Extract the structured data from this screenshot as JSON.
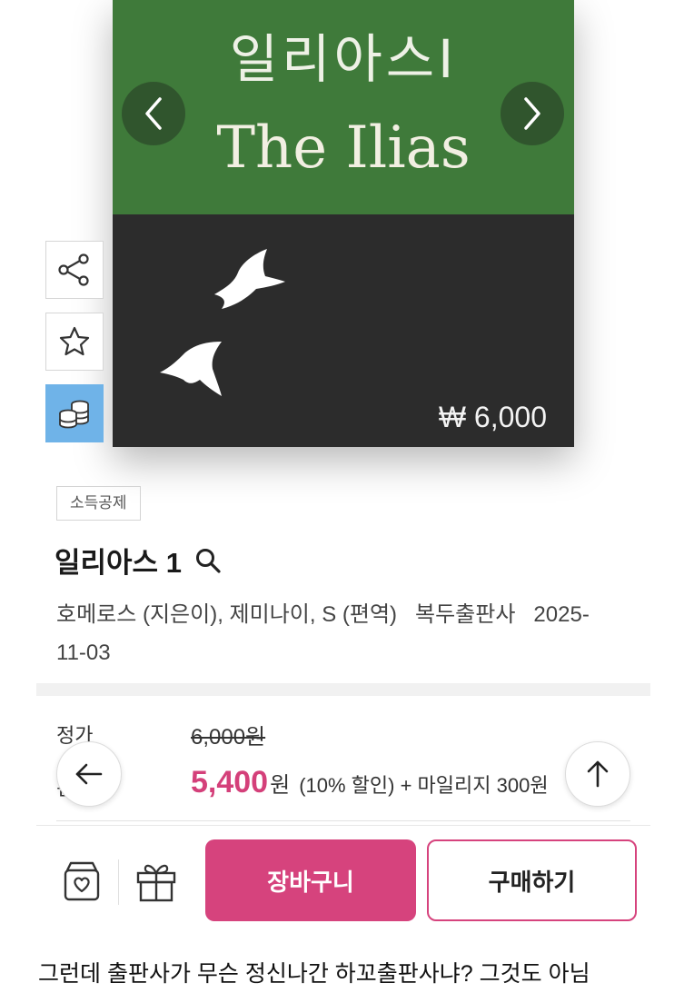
{
  "cover": {
    "title_ko": "일리아스I",
    "title_en": "The Ilias",
    "price": "₩ 6,000",
    "colors": {
      "top": "#3f7a3a",
      "bottom": "#2c2c2c"
    }
  },
  "carousel": {
    "prev_icon": "chevron-left-icon",
    "next_icon": "chevron-right-icon"
  },
  "side_actions": [
    {
      "icon": "share-icon"
    },
    {
      "icon": "star-icon"
    },
    {
      "icon": "coins-icon"
    }
  ],
  "product": {
    "tag": "소득공제",
    "title": "일리아스 1",
    "meta_line1": "호메로스 (지은이), 제미나이, S (편역)   복두출판사   2025-",
    "meta_line2": "11-03"
  },
  "pricing": {
    "list_label": "정가",
    "list_price": "6,000원",
    "sale_label": "판매가",
    "sale_price": "5,400",
    "sale_unit": "원",
    "sale_extra": "(10% 할인) + 마일리지 300원"
  },
  "actions": {
    "cart_label": "장바구니",
    "buy_label": "구매하기",
    "accent": "#d6437d"
  },
  "caption": "그런데 출판사가 무슨 정신나간 하꼬출판사냐? 그것도 아님"
}
